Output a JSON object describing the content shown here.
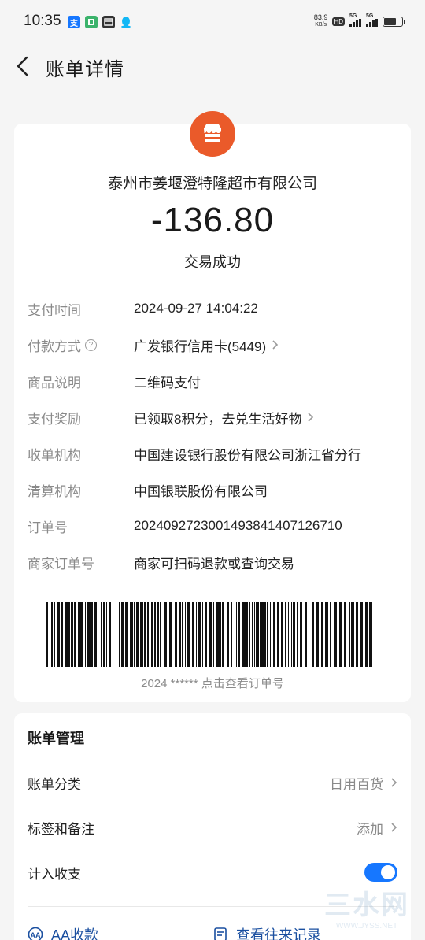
{
  "status_bar": {
    "time": "10:35",
    "speed_value": "83.9",
    "speed_unit": "KB/s",
    "hd_label": "HD",
    "signal1_label": "5G",
    "signal2_label": "5G"
  },
  "header": {
    "title": "账单详情"
  },
  "merchant": {
    "name": "泰州市姜堰澄特隆超市有限公司",
    "amount": "-136.80",
    "status": "交易成功",
    "logo_color": "#ea5a2a"
  },
  "details": [
    {
      "label": "支付时间",
      "value": "2024-09-27 14:04:22"
    },
    {
      "label": "付款方式",
      "value": "广发银行信用卡(5449)"
    },
    {
      "label": "商品说明",
      "value": "二维码支付"
    },
    {
      "label": "支付奖励",
      "value": "已领取8积分，去兑生活好物"
    },
    {
      "label": "收单机构",
      "value": "中国建设银行股份有限公司浙江省分行"
    },
    {
      "label": "清算机构",
      "value": "中国银联股份有限公司"
    },
    {
      "label": "订单号",
      "value": "2024092723001493841407126710"
    },
    {
      "label": "商家订单号",
      "value": "商家可扫码退款或查询交易"
    }
  ],
  "barcode_caption": "2024 ****** 点击查看订单号",
  "manage": {
    "title": "账单管理",
    "category_label": "账单分类",
    "category_value": "日用百货",
    "tags_label": "标签和备注",
    "tags_value": "添加",
    "count_label": "计入收支",
    "count_enabled": true
  },
  "actions": {
    "aa_label": "AA收款",
    "history_label": "查看往来记录"
  },
  "watermark": {
    "big": "三水网",
    "small": "WWW.JYSS.NET"
  },
  "colors": {
    "accent": "#1677ff",
    "label_gray": "#8a8a8a"
  }
}
